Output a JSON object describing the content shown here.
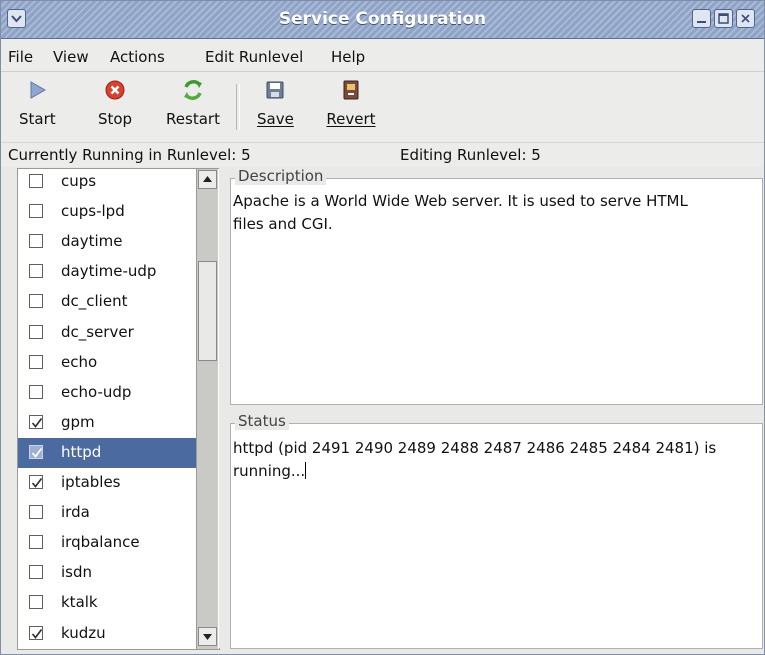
{
  "window": {
    "title": "Service Configuration"
  },
  "menubar": [
    "File",
    "View",
    "Actions",
    "Edit Runlevel",
    "Help"
  ],
  "toolbar": {
    "start_label": "Start",
    "stop_label": "Stop",
    "restart_label": "Restart",
    "save_label": "Save",
    "revert_label": "Revert"
  },
  "status": {
    "running": "Currently Running in Runlevel: 5",
    "editing": "Editing Runlevel: 5"
  },
  "services": [
    {
      "name": "cups",
      "checked": false,
      "selected": false
    },
    {
      "name": "cups-lpd",
      "checked": false,
      "selected": false
    },
    {
      "name": "daytime",
      "checked": false,
      "selected": false
    },
    {
      "name": "daytime-udp",
      "checked": false,
      "selected": false
    },
    {
      "name": "dc_client",
      "checked": false,
      "selected": false
    },
    {
      "name": "dc_server",
      "checked": false,
      "selected": false
    },
    {
      "name": "echo",
      "checked": false,
      "selected": false
    },
    {
      "name": "echo-udp",
      "checked": false,
      "selected": false
    },
    {
      "name": "gpm",
      "checked": true,
      "selected": false
    },
    {
      "name": "httpd",
      "checked": true,
      "selected": true
    },
    {
      "name": "iptables",
      "checked": true,
      "selected": false
    },
    {
      "name": "irda",
      "checked": false,
      "selected": false
    },
    {
      "name": "irqbalance",
      "checked": false,
      "selected": false
    },
    {
      "name": "isdn",
      "checked": false,
      "selected": false
    },
    {
      "name": "ktalk",
      "checked": false,
      "selected": false
    },
    {
      "name": "kudzu",
      "checked": true,
      "selected": false
    }
  ],
  "description": {
    "legend": "Description",
    "text_line1": "Apache is a World Wide Web server.  It is used to serve HTML",
    "text_line2": "files and CGI."
  },
  "status_panel": {
    "legend": "Status",
    "text_line1": "httpd (pid 2491 2490 2489 2488 2487 2486 2485 2484 2481) is",
    "text_line2": "running..."
  },
  "colors": {
    "selection": "#4b6aa0",
    "titlebar": "#8ea3c6"
  }
}
